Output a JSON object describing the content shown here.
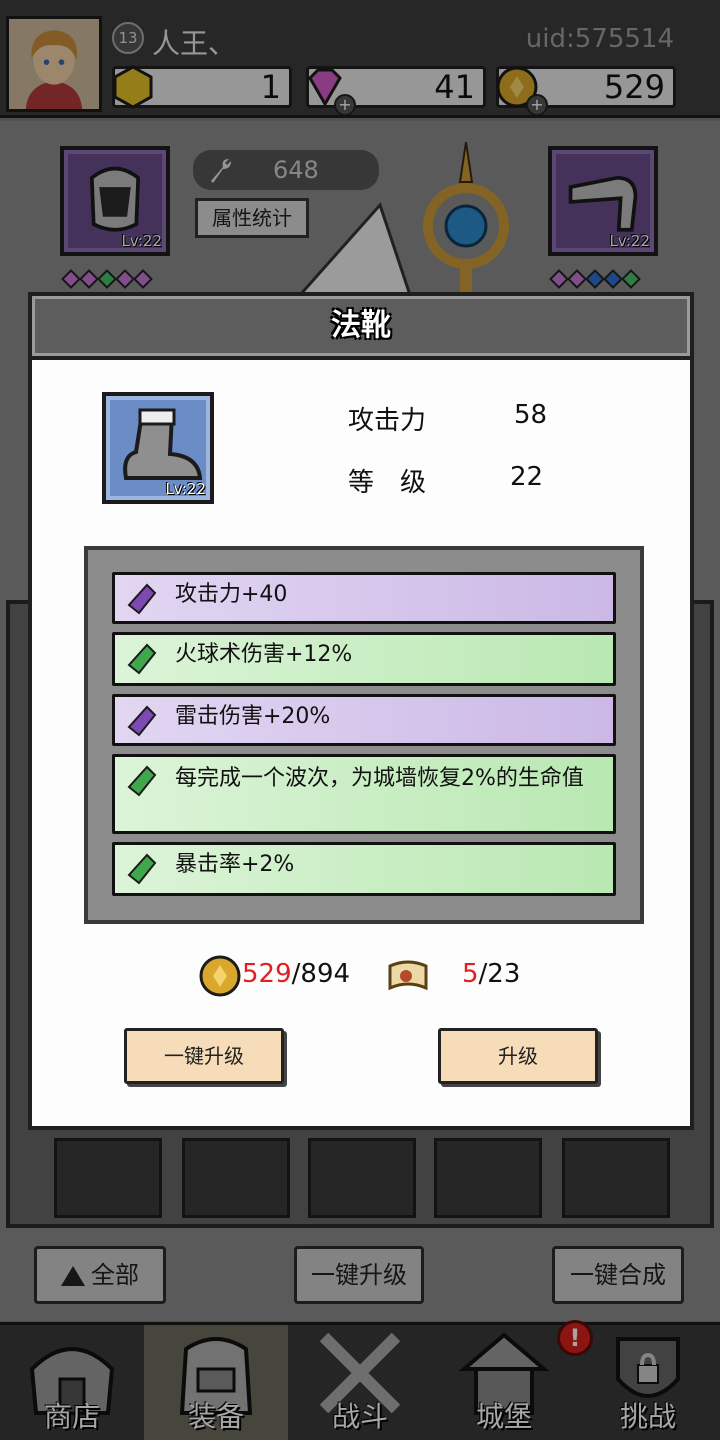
{
  "player": {
    "level": "13",
    "name": "人王、",
    "uid": "uid:575514"
  },
  "resources": {
    "energy": "1",
    "gems": "41",
    "gold": "529"
  },
  "hero": {
    "power": "648",
    "stats_button": "属性统计",
    "left_slot_level": "Lv:22",
    "right_slot_level": "Lv:22"
  },
  "dialog": {
    "title": "法靴",
    "item_level_tag": "Lv:22",
    "stats": [
      {
        "label": "攻击力",
        "value": "58"
      },
      {
        "label": "等　级",
        "value": "22"
      }
    ],
    "affixes": [
      {
        "text": "攻击力+40",
        "rarity": "purple"
      },
      {
        "text": "火球术伤害+12%",
        "rarity": "green"
      },
      {
        "text": "雷击伤害+20%",
        "rarity": "purple"
      },
      {
        "text": "每完成一个波次，为城墙恢复2%的生命值",
        "rarity": "green"
      },
      {
        "text": "暴击率+2%",
        "rarity": "green"
      }
    ],
    "gold_have": "529",
    "gold_need": "/894",
    "scroll_have": "5",
    "scroll_need": "/23",
    "btn_one_click": "一键升级",
    "btn_upgrade": "升级"
  },
  "bottom_buttons": {
    "all": "全部",
    "one_click_upgrade": "一键升级",
    "one_click_merge": "一键合成"
  },
  "nav": {
    "shop": "商店",
    "equip": "装备",
    "battle": "战斗",
    "castle": "城堡",
    "challenge": "挑战",
    "alert": "!"
  },
  "colors": {
    "purple_affix": "#cbb8e6",
    "green_affix": "#b9e8b2",
    "cost_short": "#e02020",
    "button": "#f6dcb8"
  }
}
